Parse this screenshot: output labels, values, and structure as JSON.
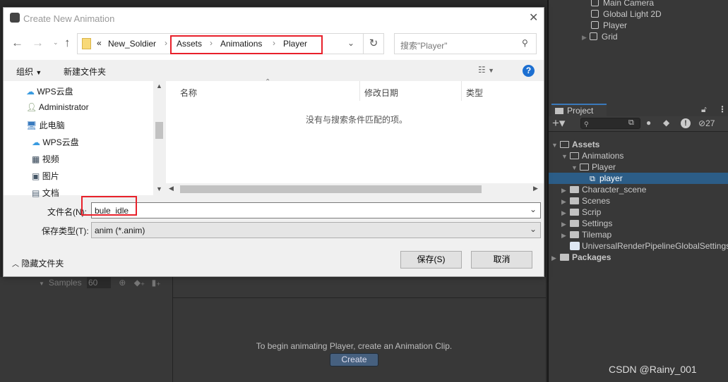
{
  "dialog": {
    "title": "Create New Animation",
    "breadcrumb": [
      "«",
      "New_Soldier",
      "Assets",
      "Animations",
      "Player"
    ],
    "search_placeholder": "搜索\"Player\"",
    "organize": "组织",
    "new_folder": "新建文件夹",
    "nav": [
      "WPS云盘",
      "Administrator",
      "此电脑",
      "WPS云盘",
      "视频",
      "图片",
      "文档"
    ],
    "columns": [
      "名称",
      "修改日期",
      "类型"
    ],
    "empty_message": "没有与搜索条件匹配的项。",
    "filename_label": "文件名(N):",
    "filename_value": "bule_idle",
    "filetype_label": "保存类型(T):",
    "filetype_value": "anim (*.anim)",
    "hide_folders": "隐藏文件夹",
    "save": "保存(S)",
    "cancel": "取消",
    "highlight_color": "#e8202a"
  },
  "hierarchy": {
    "items": [
      "Main Camera",
      "Global Light 2D",
      "Player",
      "Grid"
    ]
  },
  "project": {
    "tab": "Project",
    "hidden_count": "27",
    "tree": [
      {
        "label": "Assets"
      },
      {
        "label": "Animations"
      },
      {
        "label": "Player"
      },
      {
        "label": "player",
        "selected": true
      },
      {
        "label": "Character_scene"
      },
      {
        "label": "Scenes"
      },
      {
        "label": "Scrip"
      },
      {
        "label": "Settings"
      },
      {
        "label": "Tilemap"
      },
      {
        "label": "UniversalRenderPipelineGlobalSettings"
      },
      {
        "label": "Packages"
      }
    ],
    "selection_color": "#2c5d87"
  },
  "animation": {
    "samples_label": "Samples",
    "samples_value": "60",
    "message": "To begin animating Player, create an Animation Clip.",
    "create": "Create"
  },
  "watermark": "CSDN @Rainy_001"
}
